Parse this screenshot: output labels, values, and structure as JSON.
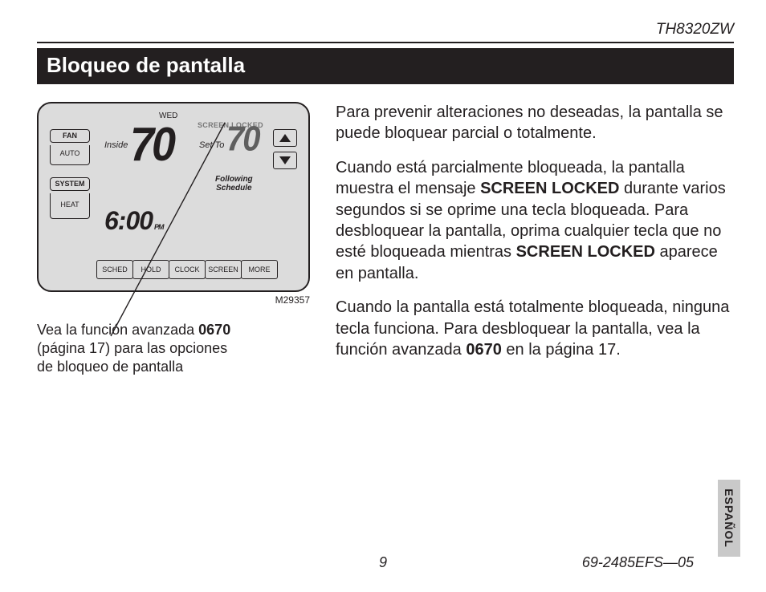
{
  "header": {
    "model": "TH8320ZW"
  },
  "title": "Bloqueo de pantalla",
  "thermo": {
    "day": "WED",
    "fan_label": "FAN",
    "fan_mode": "AUTO",
    "system_label": "SYSTEM",
    "system_mode": "HEAT",
    "inside_label": "Inside",
    "inside_temp": "70",
    "setto_label": "Set To",
    "set_temp": "70",
    "locked_msg": "SCREEN LOCKED",
    "following_line1": "Following",
    "following_line2": "Schedule",
    "time": "6:00",
    "ampm": "PM",
    "buttons": [
      "SCHED",
      "HOLD",
      "CLOCK",
      "SCREEN",
      "MORE"
    ],
    "fig_code": "M29357"
  },
  "caption": {
    "pre": "Vea la función avanzada ",
    "code": "0670",
    "post": " (página 17) para las opciones de bloqueo de pantalla"
  },
  "body": {
    "p1": "Para prevenir alteraciones no deseadas, la pantalla se puede bloquear parcial o totalmente.",
    "p2a": "Cuando está parcialmente bloqueada, la pantalla muestra el mensaje ",
    "p2b": "SCREEN LOCKED",
    "p2c": " durante varios segundos si se oprime una tecla bloqueada. Para desbloquear la pantalla, oprima cualquier tecla que no esté bloqueada mientras ",
    "p2d": "SCREEN LOCKED",
    "p2e": " aparece en pantalla.",
    "p3a": "Cuando la pantalla está totalmente bloqueada, ninguna tecla funciona. Para desbloquear la pantalla, vea la función avanzada ",
    "p3b": "0670",
    "p3c": " en la página 17."
  },
  "footer": {
    "page": "9",
    "doc": "69-2485EFS—05",
    "lang": "ESPAÑOL"
  }
}
